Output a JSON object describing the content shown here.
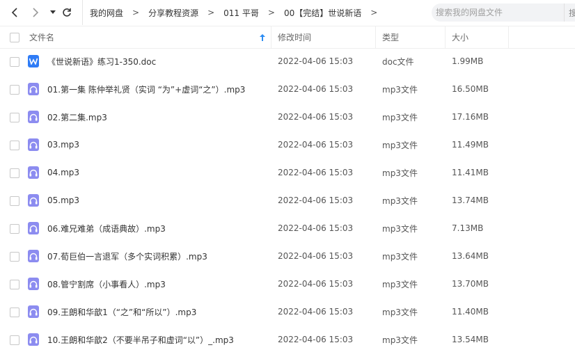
{
  "nav": {
    "back_icon": "chevron-left-icon",
    "forward_icon": "chevron-right-icon",
    "history_icon": "dropdown-triangle-icon",
    "refresh_icon": "refresh-icon"
  },
  "breadcrumbs": [
    "我的网盘",
    "分享教程资源",
    "011 平哥",
    "00【完结】世说新语"
  ],
  "breadcrumb_separator": ">",
  "search": {
    "placeholder": "搜索我的网盘文件",
    "button_label": "搜索"
  },
  "columns": {
    "name": "文件名",
    "modified": "修改时间",
    "type": "类型",
    "size": "大小",
    "sort_icon": "sort-up-arrow-icon"
  },
  "files": [
    {
      "name": "《世说新语》练习1-350.doc",
      "modified": "2022-04-06 15:03",
      "type": "doc文件",
      "size": "1.99MB",
      "icon": "word-doc-icon"
    },
    {
      "name": "01.第一集 陈仲举礼贤（实词 “为”+虚词“之”）.mp3",
      "modified": "2022-04-06 15:03",
      "type": "mp3文件",
      "size": "16.50MB",
      "icon": "audio-file-icon"
    },
    {
      "name": "02.第二集.mp3",
      "modified": "2022-04-06 15:03",
      "type": "mp3文件",
      "size": "17.16MB",
      "icon": "audio-file-icon"
    },
    {
      "name": "03.mp3",
      "modified": "2022-04-06 15:03",
      "type": "mp3文件",
      "size": "11.49MB",
      "icon": "audio-file-icon"
    },
    {
      "name": "04.mp3",
      "modified": "2022-04-06 15:03",
      "type": "mp3文件",
      "size": "11.41MB",
      "icon": "audio-file-icon"
    },
    {
      "name": "05.mp3",
      "modified": "2022-04-06 15:03",
      "type": "mp3文件",
      "size": "13.74MB",
      "icon": "audio-file-icon"
    },
    {
      "name": "06.难兄难弟（成语典故）.mp3",
      "modified": "2022-04-06 15:03",
      "type": "mp3文件",
      "size": "7.13MB",
      "icon": "audio-file-icon"
    },
    {
      "name": "07.荀巨伯一言退军（多个实词积累）.mp3",
      "modified": "2022-04-06 15:03",
      "type": "mp3文件",
      "size": "13.64MB",
      "icon": "audio-file-icon"
    },
    {
      "name": "08.管宁割席（小事看人）.mp3",
      "modified": "2022-04-06 15:03",
      "type": "mp3文件",
      "size": "13.70MB",
      "icon": "audio-file-icon"
    },
    {
      "name": "09.王朗和华歆1（“之”和“所以”）.mp3",
      "modified": "2022-04-06 15:03",
      "type": "mp3文件",
      "size": "11.40MB",
      "icon": "audio-file-icon"
    },
    {
      "name": "10.王朗和华歆2（不要半吊子和虚词“以”）_.mp3",
      "modified": "2022-04-06 15:03",
      "type": "mp3文件",
      "size": "13.54MB",
      "icon": "audio-file-icon"
    }
  ],
  "colors": {
    "doc_icon": "#2f7cf6",
    "audio_icon": "#8c8cf0",
    "sort_arrow": "#2b8cf3"
  }
}
